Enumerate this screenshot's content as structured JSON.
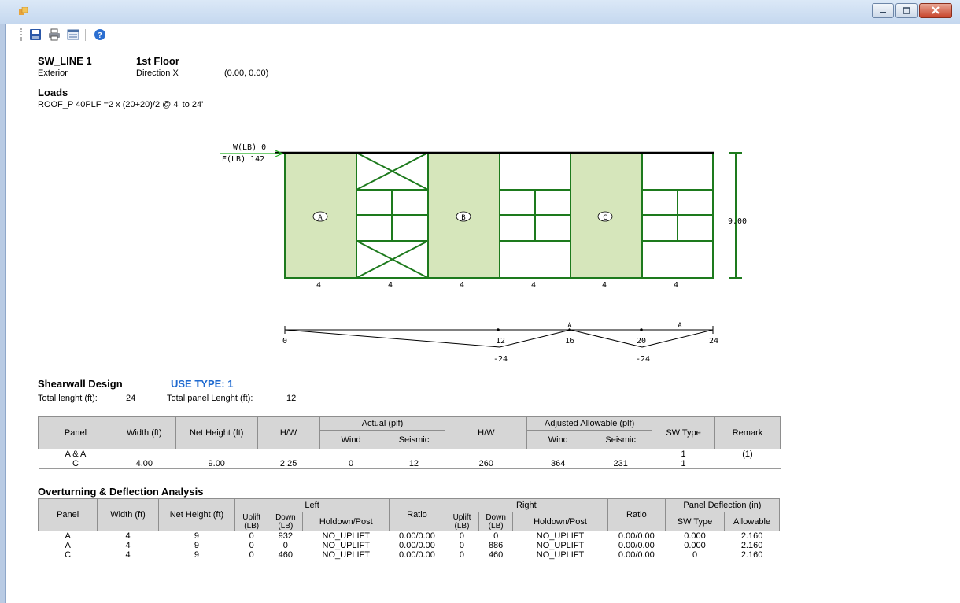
{
  "header": {
    "line_name": "SW_LINE 1",
    "floor": "1st Floor",
    "side": "Exterior",
    "direction": "Direction X",
    "coords": "(0.00, 0.00)"
  },
  "loads": {
    "title": "Loads",
    "roof": "ROOF_P  40PLF =2 x (20+20)/2  @ 4' to 24'"
  },
  "wall": {
    "wind_label": "W(LB) 0",
    "seismic_label": "E(LB)  142",
    "panel_labels": [
      "A",
      "B",
      "C"
    ],
    "segment_widths": [
      "4",
      "4",
      "4",
      "4",
      "4",
      "4"
    ],
    "height": "9.00"
  },
  "diagram": {
    "x_labels": [
      "0",
      "12",
      "16",
      "20",
      "24"
    ],
    "neg_labels": [
      "-24",
      "-24"
    ],
    "a_labels": [
      "A",
      "A"
    ]
  },
  "design": {
    "title": "Shearwall Design",
    "use_type": "USE TYPE: 1",
    "total_length_label": "Total lenght (ft):",
    "total_length": "24",
    "panel_length_label": "Total panel Lenght (ft):",
    "panel_length": "12"
  },
  "table1": {
    "headers": {
      "panel": "Panel",
      "width": "Width (ft)",
      "net_height": "Net Height (ft)",
      "hw": "H/W",
      "actual": "Actual (plf)",
      "wind": "Wind",
      "seismic": "Seismic",
      "hw2": "H/W",
      "adjusted": "Adjusted Allowable (plf)",
      "wind2": "Wind",
      "seismic2": "Seismic",
      "sw_type": "SW Type",
      "remark": "Remark"
    },
    "rows": [
      [
        "A & A",
        "",
        "",
        "",
        "",
        "",
        "",
        "",
        "",
        "1",
        "(1)"
      ],
      [
        "C",
        "4.00",
        "9.00",
        "2.25",
        "0",
        "12",
        "260",
        "364",
        "231",
        "1",
        ""
      ]
    ]
  },
  "overturning": {
    "title": "Overturning & Deflection Analysis",
    "headers": {
      "panel": "Panel",
      "width": "Width (ft)",
      "net_height": "Net Height (ft)",
      "left": "Left",
      "uplift": "Uplift (LB)",
      "down": "Down (LB)",
      "holdown": "Holdown/Post",
      "ratio": "Ratio",
      "right": "Right",
      "uplift2": "Uplift (LB)",
      "down2": "Down (LB)",
      "holdown2": "Holdown/Post",
      "ratio2": "Ratio",
      "deflection": "Panel Deflection (in)",
      "sw_type": "SW Type",
      "allowable": "Allowable"
    },
    "rows": [
      [
        "A",
        "4",
        "9",
        "0",
        "932",
        "NO_UPLIFT",
        "0.00/0.00",
        "0",
        "0",
        "NO_UPLIFT",
        "0.00/0.00",
        "0.000",
        "2.160"
      ],
      [
        "A",
        "4",
        "9",
        "0",
        "0",
        "NO_UPLIFT",
        "0.00/0.00",
        "0",
        "886",
        "NO_UPLIFT",
        "0.00/0.00",
        "0.000",
        "2.160"
      ],
      [
        "C",
        "4",
        "9",
        "0",
        "460",
        "NO_UPLIFT",
        "0.00/0.00",
        "0",
        "460",
        "NO_UPLIFT",
        "0.00/0.00",
        "0",
        "2.160"
      ]
    ]
  },
  "toolbar_icons": [
    "save-icon",
    "print-icon",
    "view-icon",
    "help-icon"
  ],
  "colors": {
    "panel_fill": "#d6e6bb",
    "frame": "#1d7a1d",
    "accent": "#1f6ad0"
  }
}
